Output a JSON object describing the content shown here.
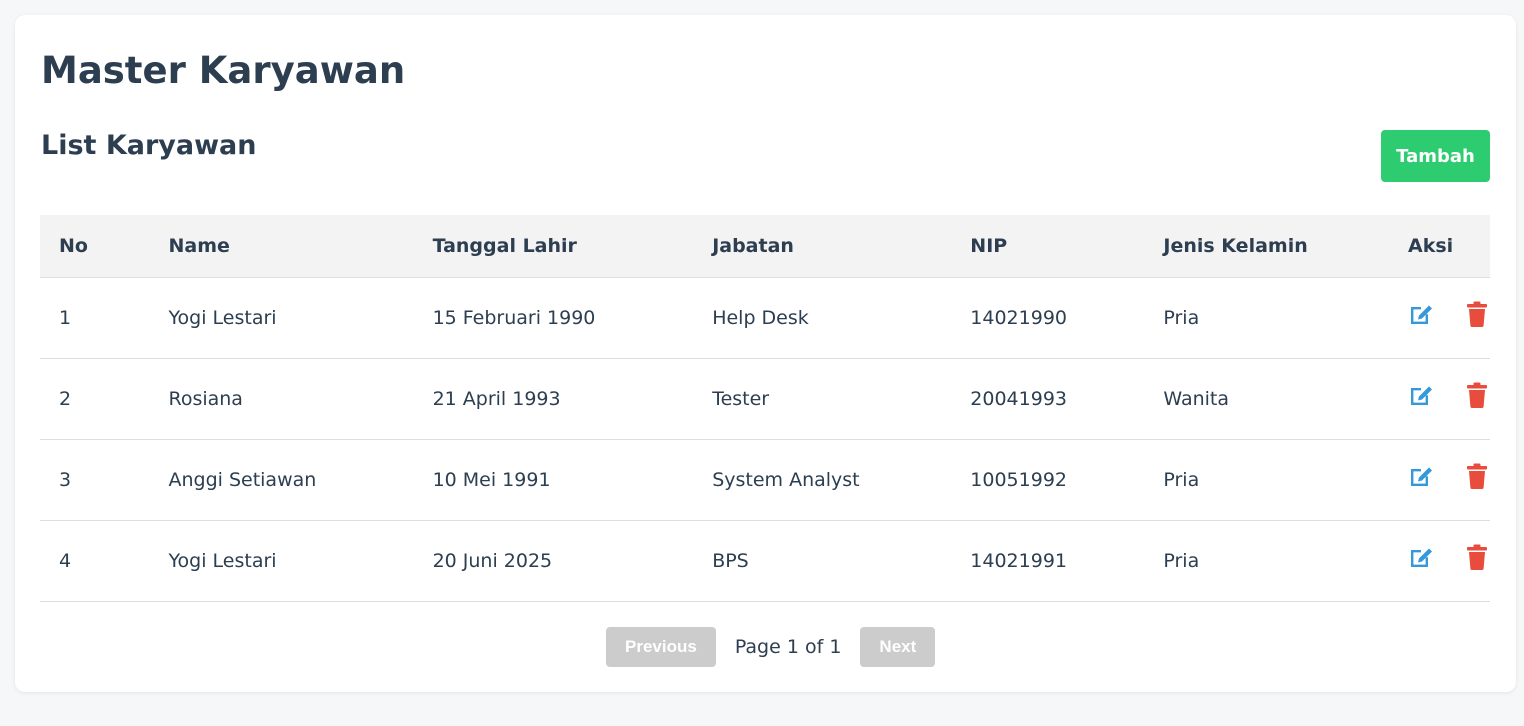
{
  "header": {
    "title": "Master Karyawan",
    "subtitle": "List Karyawan",
    "add_label": "Tambah"
  },
  "table": {
    "columns": [
      "No",
      "Name",
      "Tanggal Lahir",
      "Jabatan",
      "NIP",
      "Jenis Kelamin",
      "Aksi"
    ],
    "rows": [
      {
        "no": "1",
        "name": "Yogi Lestari",
        "dob": "15 Februari 1990",
        "job": "Help Desk",
        "nip": "14021990",
        "gender": "Pria"
      },
      {
        "no": "2",
        "name": "Rosiana",
        "dob": "21 April 1993",
        "job": "Tester",
        "nip": "20041993",
        "gender": "Wanita"
      },
      {
        "no": "3",
        "name": "Anggi Setiawan",
        "dob": "10 Mei 1991",
        "job": "System Analyst",
        "nip": "10051992",
        "gender": "Pria"
      },
      {
        "no": "4",
        "name": "Yogi Lestari",
        "dob": "20 Juni 2025",
        "job": "BPS",
        "nip": "14021991",
        "gender": "Pria"
      }
    ],
    "actions": {
      "edit_icon": "edit-icon",
      "delete_icon": "trash-icon"
    }
  },
  "pagination": {
    "previous_label": "Previous",
    "page_info": "Page 1 of 1",
    "next_label": "Next"
  },
  "colors": {
    "primary_text": "#2c3e50",
    "add_button": "#2ecc71",
    "edit_icon": "#3498db",
    "delete_icon": "#e74c3c",
    "disabled_button": "#cccccc"
  }
}
